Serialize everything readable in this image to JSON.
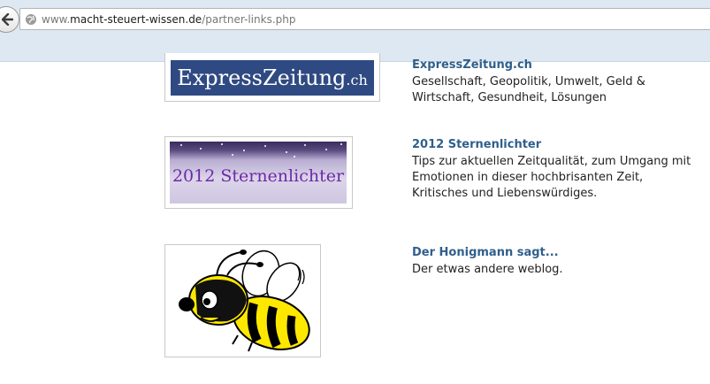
{
  "browser": {
    "url_prefix": "www.",
    "url_domain": "macht-steuert-wissen.de",
    "url_path": "/partner-links.php"
  },
  "entries": [
    {
      "image_text": "ExpressZeitung",
      "image_suffix": ".ch",
      "title": "ExpressZeitung.ch",
      "description": "Gesellschaft, Geopolitik, Umwelt, Geld & Wirtschaft, Gesundheit, Lösungen"
    },
    {
      "image_text": "2012 Sternenlichter",
      "title": "2012 Sternenlichter",
      "description": "Tips zur aktuellen Zeitqualität, zum Umgang mit Emotionen in dieser hochbrisanten Zeit, Kritisches und Liebenswürdiges."
    },
    {
      "image_icon": "bee-cartoon-icon",
      "title": "Der Honigmann sagt...",
      "description": "Der etwas andere weblog."
    }
  ],
  "colors": {
    "link": "#2f5f8c",
    "chrome_bg": "#dde8f3",
    "expresszeitung_banner": "#2f4a82",
    "sternenlichter_text": "#6a2aa8"
  }
}
